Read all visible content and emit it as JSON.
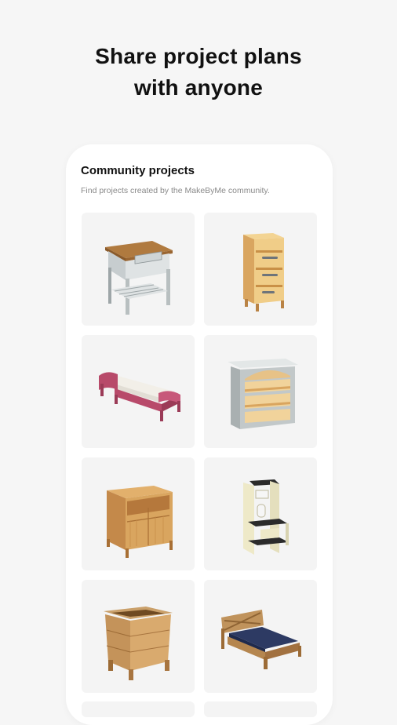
{
  "headline": {
    "line1": "Share project plans",
    "line2": "with anyone"
  },
  "community": {
    "title": "Community projects",
    "subtitle": "Find projects created by the MakeByMe community."
  },
  "projects": [
    {
      "icon": "nightstand-icon"
    },
    {
      "icon": "drawer-cabinet-icon"
    },
    {
      "icon": "toddler-bed-icon"
    },
    {
      "icon": "bookshelf-icon"
    },
    {
      "icon": "wood-dresser-icon"
    },
    {
      "icon": "learning-tower-icon"
    },
    {
      "icon": "planter-box-icon"
    },
    {
      "icon": "bed-frame-icon"
    }
  ],
  "colors": {
    "background": "#f6f6f6",
    "card": "#f4f4f4",
    "wood": "#d9a55f",
    "wood_dark": "#a86f34",
    "pink": "#b84a6a",
    "gray": "#b8bfc0"
  }
}
